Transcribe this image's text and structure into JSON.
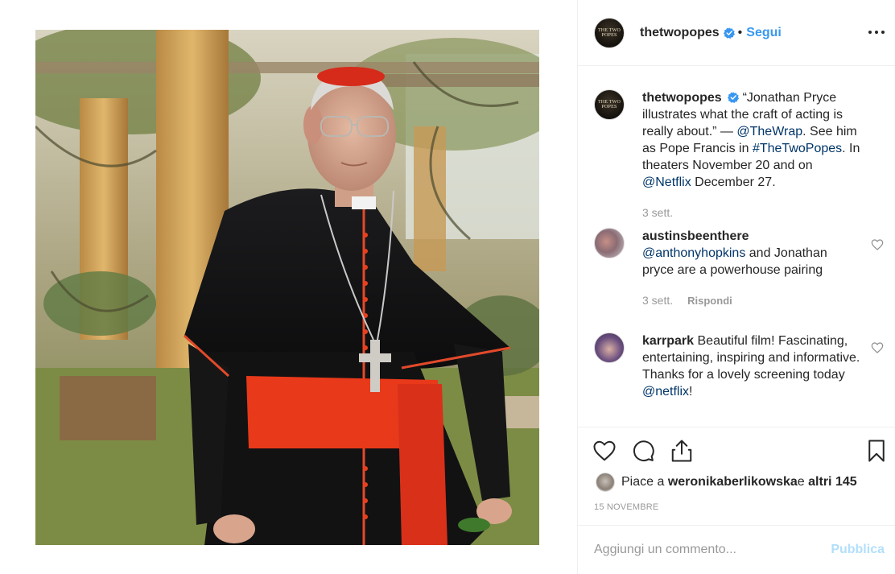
{
  "post": {
    "username": "thetwopopes",
    "follow_label": "Segui",
    "separator": "•",
    "avatar_text": "THE TWO POPES",
    "caption_username": "thetwopopes",
    "caption_part1": "“Jonathan Pryce illustrates what the craft of acting is really about.” — ",
    "caption_mention1": "@TheWrap",
    "caption_part2": ". See him as Pope Francis in ",
    "caption_hashtag": "#TheTwoPopes",
    "caption_part3": ". In theaters November 20 and on ",
    "caption_mention2": "@Netflix",
    "caption_part4": " December 27.",
    "caption_time": "3 sett."
  },
  "comments": [
    {
      "username": "austinsbeenthere",
      "mention": "@anthonyhopkins",
      "text": " and Jonathan pryce are a powerhouse pairing",
      "time": "3 sett.",
      "reply_label": "Rispondi"
    },
    {
      "username": "karrpark",
      "text": " Beautiful film! Fascinating, entertaining, inspiring and informative. Thanks for a lovely screening today ",
      "mention": "@netflix",
      "suffix": "!"
    }
  ],
  "likes": {
    "prefix": "Piace a ",
    "user": "weronikaberlikowska",
    "middle": " e ",
    "others": "altri 145"
  },
  "date": "15 NOVEMBRE",
  "add_comment": {
    "placeholder": "Aggiungi un commento...",
    "publish_label": "Pubblica"
  },
  "colors": {
    "link": "#003569",
    "follow": "#3897f0",
    "verified": "#3897f0",
    "muted": "#999999",
    "publish_disabled": "#b2dffc"
  },
  "icons": [
    "verified-icon",
    "more-options-icon",
    "heart-icon",
    "comment-icon",
    "share-icon",
    "bookmark-icon"
  ]
}
